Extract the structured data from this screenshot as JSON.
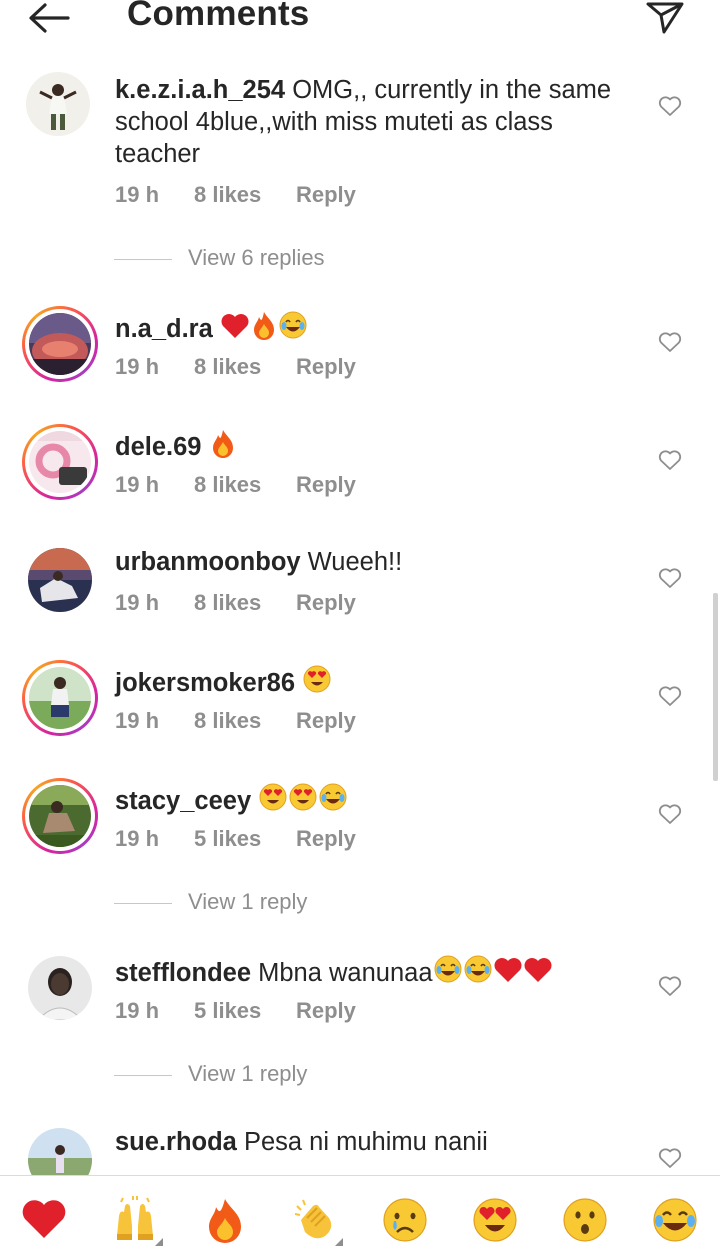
{
  "header": {
    "title": "Comments",
    "back_icon": "arrow-left-icon",
    "send_icon": "paper-plane-icon"
  },
  "comments": [
    {
      "username": "k.e.z.i.a.h_254",
      "text": "OMG,, currently in the same school 4blue,,with miss muteti as class teacher",
      "emojis": [],
      "time": "19 h",
      "likes": "8 likes",
      "reply": "Reply",
      "story_ring": false,
      "view_replies": "View 6 replies"
    },
    {
      "username": "n.a_d.ra",
      "text": "",
      "emojis": [
        "red-heart",
        "fire",
        "joy"
      ],
      "time": "19 h",
      "likes": "8 likes",
      "reply": "Reply",
      "story_ring": true
    },
    {
      "username": "dele.69",
      "text": "",
      "emojis": [
        "fire"
      ],
      "time": "19 h",
      "likes": "8 likes",
      "reply": "Reply",
      "story_ring": true
    },
    {
      "username": "urbanmoonboy",
      "text": "Wueeh!!",
      "emojis": [],
      "time": "19 h",
      "likes": "8 likes",
      "reply": "Reply",
      "story_ring": false
    },
    {
      "username": "jokersmoker86",
      "text": "",
      "emojis": [
        "heart-eyes"
      ],
      "time": "19 h",
      "likes": "8 likes",
      "reply": "Reply",
      "story_ring": true
    },
    {
      "username": "stacy_ceey",
      "text": "",
      "emojis": [
        "heart-eyes",
        "heart-eyes",
        "joy"
      ],
      "time": "19 h",
      "likes": "5 likes",
      "reply": "Reply",
      "story_ring": true,
      "view_replies": "View 1 reply"
    },
    {
      "username": "stefflondee",
      "text": "Mbna wanunaa",
      "emojis": [
        "joy",
        "joy",
        "red-heart",
        "red-heart"
      ],
      "time": "19 h",
      "likes": "5 likes",
      "reply": "Reply",
      "story_ring": false,
      "view_replies": "View 1 reply"
    },
    {
      "username": "sue.rhoda",
      "text": "Pesa ni muhimu nanii",
      "emojis": [],
      "time": "",
      "likes": "",
      "reply": "",
      "story_ring": false
    }
  ],
  "reaction_bar": {
    "emojis": [
      "red-heart",
      "raising-hands",
      "fire",
      "clapping-hands",
      "crying-face",
      "heart-eyes",
      "surprised-face",
      "joy"
    ]
  },
  "colors": {
    "text": "#262626",
    "secondary": "#8e8e8e",
    "ring_start": "#d6249f",
    "ring_end": "#f5a623",
    "heart": "#ed1c24"
  }
}
